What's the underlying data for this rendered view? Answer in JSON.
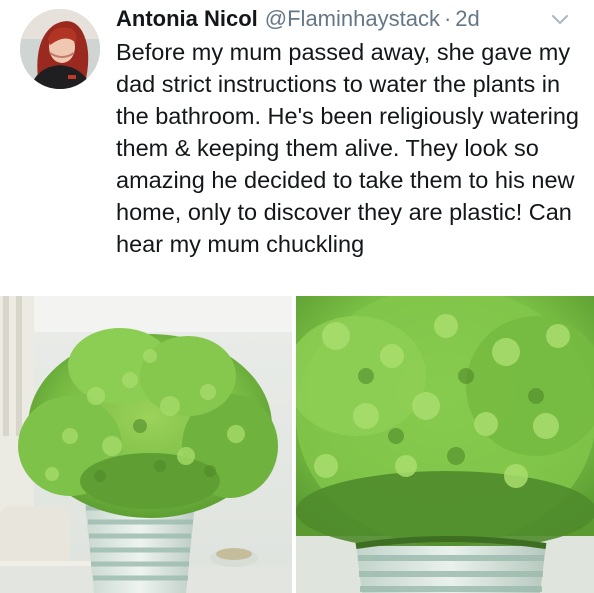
{
  "tweet": {
    "author_name": "Antonia Nicol",
    "handle": "@Flaminhaystack",
    "separator": "·",
    "age": "2d",
    "text": "Before my mum passed away, she gave my dad strict instructions to water the plants in the bathroom. He's been religiously watering them & keeping them alive. They look so amazing he decided to take them to his new home, only to discover they are plastic! Can hear my mum chuckling"
  },
  "icons": {
    "avatar": "avatar-photo",
    "menu": "chevron-down-icon"
  },
  "media": {
    "count": 2
  },
  "colors": {
    "text": "#14171a",
    "secondary": "#657786",
    "background": "#ffffff",
    "leaf": "#7fc24a",
    "pot_stripe": "#b8cfc4"
  }
}
